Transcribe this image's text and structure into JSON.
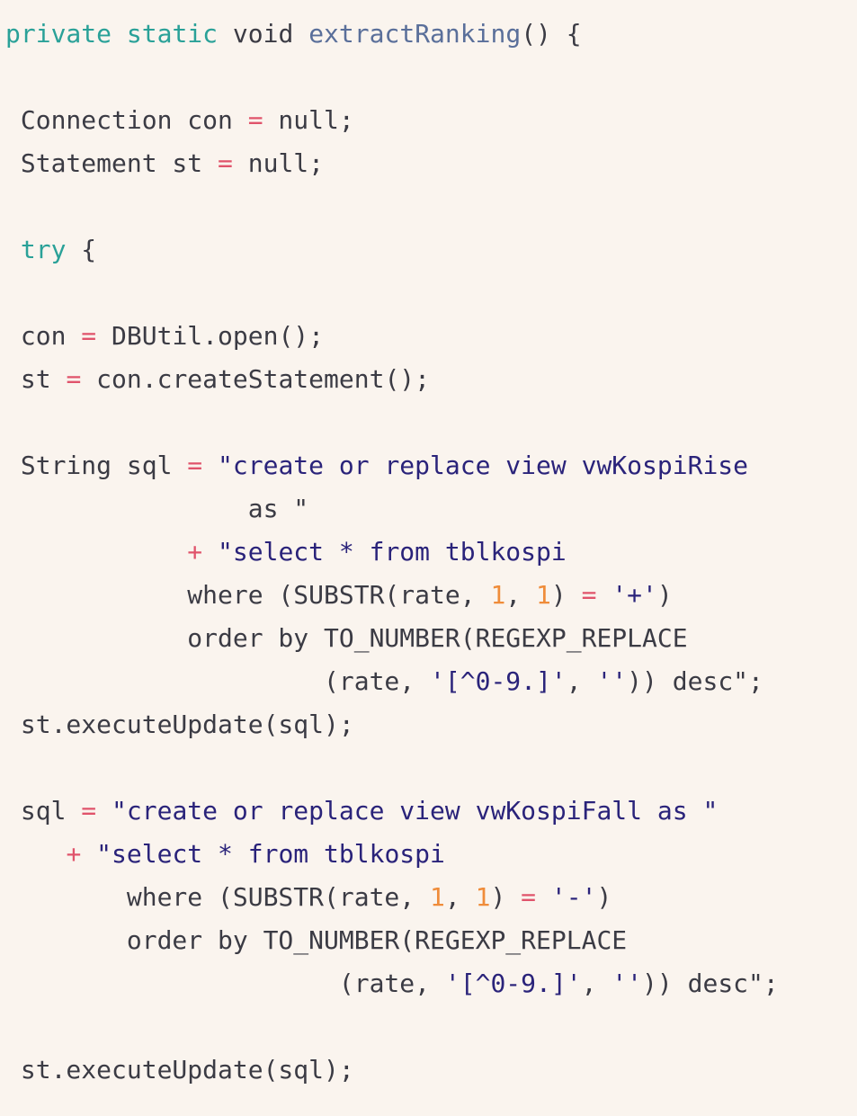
{
  "editor": {
    "language": "java",
    "colors": {
      "background": "#faf4ee",
      "plain": "#3b3b44",
      "keyword": "#2aa198",
      "function": "#5a6f9a",
      "operator": "#e0536b",
      "string": "#2a237a",
      "number": "#ef8c3a"
    },
    "lines": [
      [
        {
          "t": "private",
          "c": "kw"
        },
        {
          "t": " ",
          "c": "plain"
        },
        {
          "t": "static",
          "c": "kw"
        },
        {
          "t": " void ",
          "c": "plain"
        },
        {
          "t": "extractRanking",
          "c": "fn"
        },
        {
          "t": "() {",
          "c": "plain"
        }
      ],
      [],
      [
        {
          "t": " Connection con ",
          "c": "plain"
        },
        {
          "t": "=",
          "c": "op"
        },
        {
          "t": " null;",
          "c": "plain"
        }
      ],
      [
        {
          "t": " Statement st ",
          "c": "plain"
        },
        {
          "t": "=",
          "c": "op"
        },
        {
          "t": " null;",
          "c": "plain"
        }
      ],
      [],
      [
        {
          "t": " ",
          "c": "plain"
        },
        {
          "t": "try",
          "c": "kw"
        },
        {
          "t": " {",
          "c": "plain"
        }
      ],
      [],
      [
        {
          "t": " con ",
          "c": "plain"
        },
        {
          "t": "=",
          "c": "op"
        },
        {
          "t": " DBUtil.open();",
          "c": "plain"
        }
      ],
      [
        {
          "t": " st ",
          "c": "plain"
        },
        {
          "t": "=",
          "c": "op"
        },
        {
          "t": " con.createStatement();",
          "c": "plain"
        }
      ],
      [],
      [
        {
          "t": " String sql ",
          "c": "plain"
        },
        {
          "t": "=",
          "c": "op"
        },
        {
          "t": " ",
          "c": "plain"
        },
        {
          "t": "\"create or replace view vwKospiRise",
          "c": "str"
        }
      ],
      [
        {
          "t": "                as \"",
          "c": "plain"
        }
      ],
      [
        {
          "t": "            ",
          "c": "plain"
        },
        {
          "t": "+",
          "c": "op"
        },
        {
          "t": " ",
          "c": "plain"
        },
        {
          "t": "\"select * from tblkospi",
          "c": "str"
        }
      ],
      [
        {
          "t": "            where (SUBSTR(rate, ",
          "c": "plain"
        },
        {
          "t": "1",
          "c": "num"
        },
        {
          "t": ", ",
          "c": "plain"
        },
        {
          "t": "1",
          "c": "num"
        },
        {
          "t": ") ",
          "c": "plain"
        },
        {
          "t": "=",
          "c": "op"
        },
        {
          "t": " ",
          "c": "plain"
        },
        {
          "t": "'+'",
          "c": "str"
        },
        {
          "t": ")",
          "c": "plain"
        }
      ],
      [
        {
          "t": "            order by TO_NUMBER(REGEXP_REPLACE",
          "c": "plain"
        }
      ],
      [
        {
          "t": "                     (rate, ",
          "c": "plain"
        },
        {
          "t": "'[^0-9.]'",
          "c": "str"
        },
        {
          "t": ", ",
          "c": "plain"
        },
        {
          "t": "''",
          "c": "str"
        },
        {
          "t": ")) desc\";",
          "c": "plain"
        }
      ],
      [
        {
          "t": " st.executeUpdate(sql);",
          "c": "plain"
        }
      ],
      [],
      [
        {
          "t": " sql ",
          "c": "plain"
        },
        {
          "t": "=",
          "c": "op"
        },
        {
          "t": " ",
          "c": "plain"
        },
        {
          "t": "\"create or replace view vwKospiFall as \"",
          "c": "str"
        }
      ],
      [
        {
          "t": "    ",
          "c": "plain"
        },
        {
          "t": "+",
          "c": "op"
        },
        {
          "t": " ",
          "c": "plain"
        },
        {
          "t": "\"select * from tblkospi",
          "c": "str"
        }
      ],
      [
        {
          "t": "        where (SUBSTR(rate, ",
          "c": "plain"
        },
        {
          "t": "1",
          "c": "num"
        },
        {
          "t": ", ",
          "c": "plain"
        },
        {
          "t": "1",
          "c": "num"
        },
        {
          "t": ") ",
          "c": "plain"
        },
        {
          "t": "=",
          "c": "op"
        },
        {
          "t": " ",
          "c": "plain"
        },
        {
          "t": "'-'",
          "c": "str"
        },
        {
          "t": ")",
          "c": "plain"
        }
      ],
      [
        {
          "t": "        order by TO_NUMBER(REGEXP_REPLACE",
          "c": "plain"
        }
      ],
      [
        {
          "t": "                      (rate, ",
          "c": "plain"
        },
        {
          "t": "'[^0-9.]'",
          "c": "str"
        },
        {
          "t": ", ",
          "c": "plain"
        },
        {
          "t": "''",
          "c": "str"
        },
        {
          "t": ")) desc\";",
          "c": "plain"
        }
      ],
      [],
      [
        {
          "t": " st.executeUpdate(sql);",
          "c": "plain"
        }
      ]
    ]
  }
}
